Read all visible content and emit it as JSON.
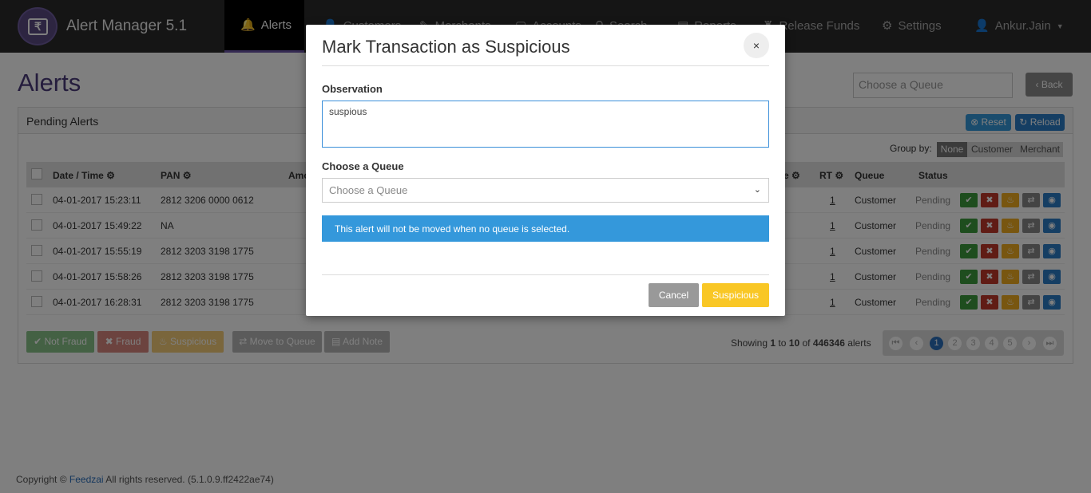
{
  "app": {
    "title": "Alert Manager 5.1",
    "logo_glyph": "₹"
  },
  "nav": [
    {
      "label": "Alerts",
      "icon": "bell-icon",
      "active": true
    },
    {
      "label": "Customers",
      "icon": "user-icon"
    },
    {
      "label": "Merchants",
      "icon": "merchant-icon"
    },
    {
      "label": "Accounts",
      "icon": "account-icon"
    },
    {
      "label": "Search",
      "icon": "search-icon"
    },
    {
      "label": "Reports",
      "icon": "report-icon"
    },
    {
      "label": "Release Funds",
      "icon": "funds-icon"
    },
    {
      "label": "Settings",
      "icon": "gear-icon"
    },
    {
      "label": "Ankur.Jain",
      "icon": "user-icon"
    }
  ],
  "page": {
    "title": "Alerts",
    "queue_placeholder": "Choose a Queue",
    "back_label": "Back"
  },
  "panel": {
    "title": "Pending Alerts",
    "reset_label": "Reset",
    "reload_label": "Reload",
    "group_by_label": "Group by:",
    "group_options": [
      "None",
      "Customer",
      "Merchant"
    ]
  },
  "table": {
    "headers": {
      "date": "Date / Time",
      "pan": "PAN",
      "amount": "Amo",
      "score": "e",
      "rt": "RT",
      "queue": "Queue",
      "status": "Status"
    },
    "rows": [
      {
        "date": "04-01-2017 15:23:11",
        "pan": "2812 3206 0000 0612",
        "rt": "1",
        "queue": "Customer",
        "status": "Pending"
      },
      {
        "date": "04-01-2017 15:49:22",
        "pan": "NA",
        "rt": "1",
        "queue": "Customer",
        "status": "Pending"
      },
      {
        "date": "04-01-2017 15:55:19",
        "pan": "2812 3203 3198 1775",
        "rt": "1",
        "queue": "Customer",
        "status": "Pending"
      },
      {
        "date": "04-01-2017 15:58:26",
        "pan": "2812 3203 3198 1775",
        "rt": "1",
        "queue": "Customer",
        "status": "Pending"
      },
      {
        "date": "04-01-2017 16:28:31",
        "pan": "2812 3203 3198 1775",
        "rt": "1",
        "queue": "Customer",
        "status": "Pending"
      }
    ]
  },
  "footer_actions": {
    "not_fraud": "Not Fraud",
    "fraud": "Fraud",
    "suspicious": "Suspicious",
    "move_to_queue": "Move to Queue",
    "add_note": "Add Note"
  },
  "pagination": {
    "showing_prefix": "Showing",
    "from": "1",
    "to_word": "to",
    "to": "10",
    "of_word": "of",
    "total": "446346",
    "suffix": "alerts",
    "pages": [
      "1",
      "2",
      "3",
      "4",
      "5"
    ],
    "current": "1"
  },
  "footer": {
    "prefix": "Copyright ©",
    "company": "Feedzai",
    "suffix": "All rights reserved. (5.1.0.9.ff2422ae74)"
  },
  "modal": {
    "title": "Mark Transaction as Suspicious",
    "close_glyph": "×",
    "observation_label": "Observation",
    "observation_value": "suspious",
    "queue_label": "Choose a Queue",
    "queue_placeholder": "Choose a Queue",
    "info_text": "This alert will not be moved when no queue is selected.",
    "cancel_label": "Cancel",
    "confirm_label": "Suspicious"
  },
  "colors": {
    "accent": "#6a55a6",
    "info": "#3498db",
    "warning": "#f9c725",
    "success": "#3c9a3c",
    "danger": "#c0392b"
  }
}
